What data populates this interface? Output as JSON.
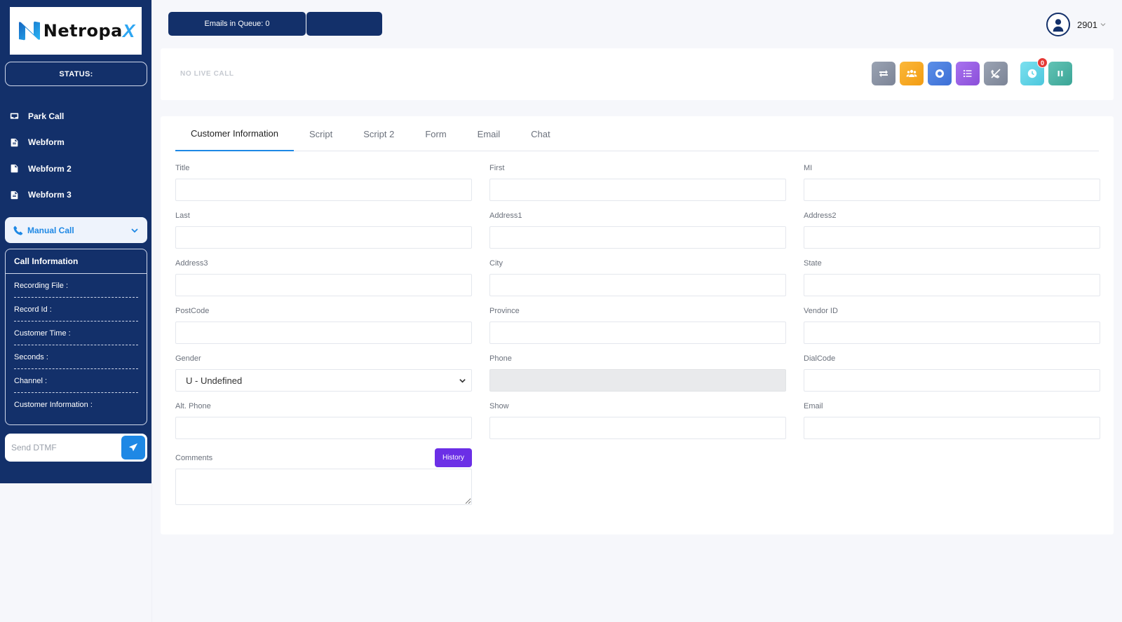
{
  "sidebar": {
    "logo_text": "Netropa",
    "logo_x": "X",
    "status_label": "STATUS:",
    "nav": [
      {
        "label": "Park Call",
        "icon": "park-call-icon"
      },
      {
        "label": "Webform",
        "icon": "document-icon"
      },
      {
        "label": "Webform 2",
        "icon": "document-icon"
      },
      {
        "label": "Webform 3",
        "icon": "document-icon"
      }
    ],
    "manual_call_label": "Manual Call",
    "call_info": {
      "title": "Call Information",
      "rows": [
        "Recording File :",
        "Record Id :",
        "Customer Time :",
        "Seconds :",
        "Channel :",
        "Customer Information :"
      ]
    },
    "dtmf_placeholder": "Send DTMF"
  },
  "topbar": {
    "emails_queue": "Emails in Queue: 0",
    "user_name": "2901"
  },
  "livecall": {
    "status_text": "NO LIVE CALL",
    "tools": [
      {
        "icon": "transfer-icon",
        "color": "#8e96a6"
      },
      {
        "icon": "group-icon",
        "color": "#f6a623"
      },
      {
        "icon": "record-icon",
        "color": "#4d7fe0"
      },
      {
        "icon": "list-icon",
        "color": "#9b5de5"
      },
      {
        "icon": "hangup-icon",
        "color": "#8e96a6"
      },
      {
        "icon": "clock-icon",
        "color": "#5dd3e6",
        "badge": "0"
      },
      {
        "icon": "pause-icon",
        "color": "#4ab3a5"
      }
    ]
  },
  "tabs": [
    "Customer Information",
    "Script",
    "Script 2",
    "Form",
    "Email",
    "Chat"
  ],
  "form": {
    "title": {
      "label": "Title",
      "value": ""
    },
    "first": {
      "label": "First",
      "value": ""
    },
    "mi": {
      "label": "MI",
      "value": ""
    },
    "last": {
      "label": "Last",
      "value": ""
    },
    "address1": {
      "label": "Address1",
      "value": ""
    },
    "address2": {
      "label": "Address2",
      "value": ""
    },
    "address3": {
      "label": "Address3",
      "value": ""
    },
    "city": {
      "label": "City",
      "value": ""
    },
    "state": {
      "label": "State",
      "value": ""
    },
    "postcode": {
      "label": "PostCode",
      "value": ""
    },
    "province": {
      "label": "Province",
      "value": ""
    },
    "vendor_id": {
      "label": "Vendor ID",
      "value": ""
    },
    "gender": {
      "label": "Gender",
      "value": "U - Undefined"
    },
    "phone": {
      "label": "Phone",
      "value": ""
    },
    "dialcode": {
      "label": "DialCode",
      "value": ""
    },
    "alt_phone": {
      "label": "Alt. Phone",
      "value": ""
    },
    "show": {
      "label": "Show",
      "value": ""
    },
    "email": {
      "label": "Email",
      "value": ""
    },
    "comments": {
      "label": "Comments",
      "value": ""
    },
    "history_label": "History"
  }
}
